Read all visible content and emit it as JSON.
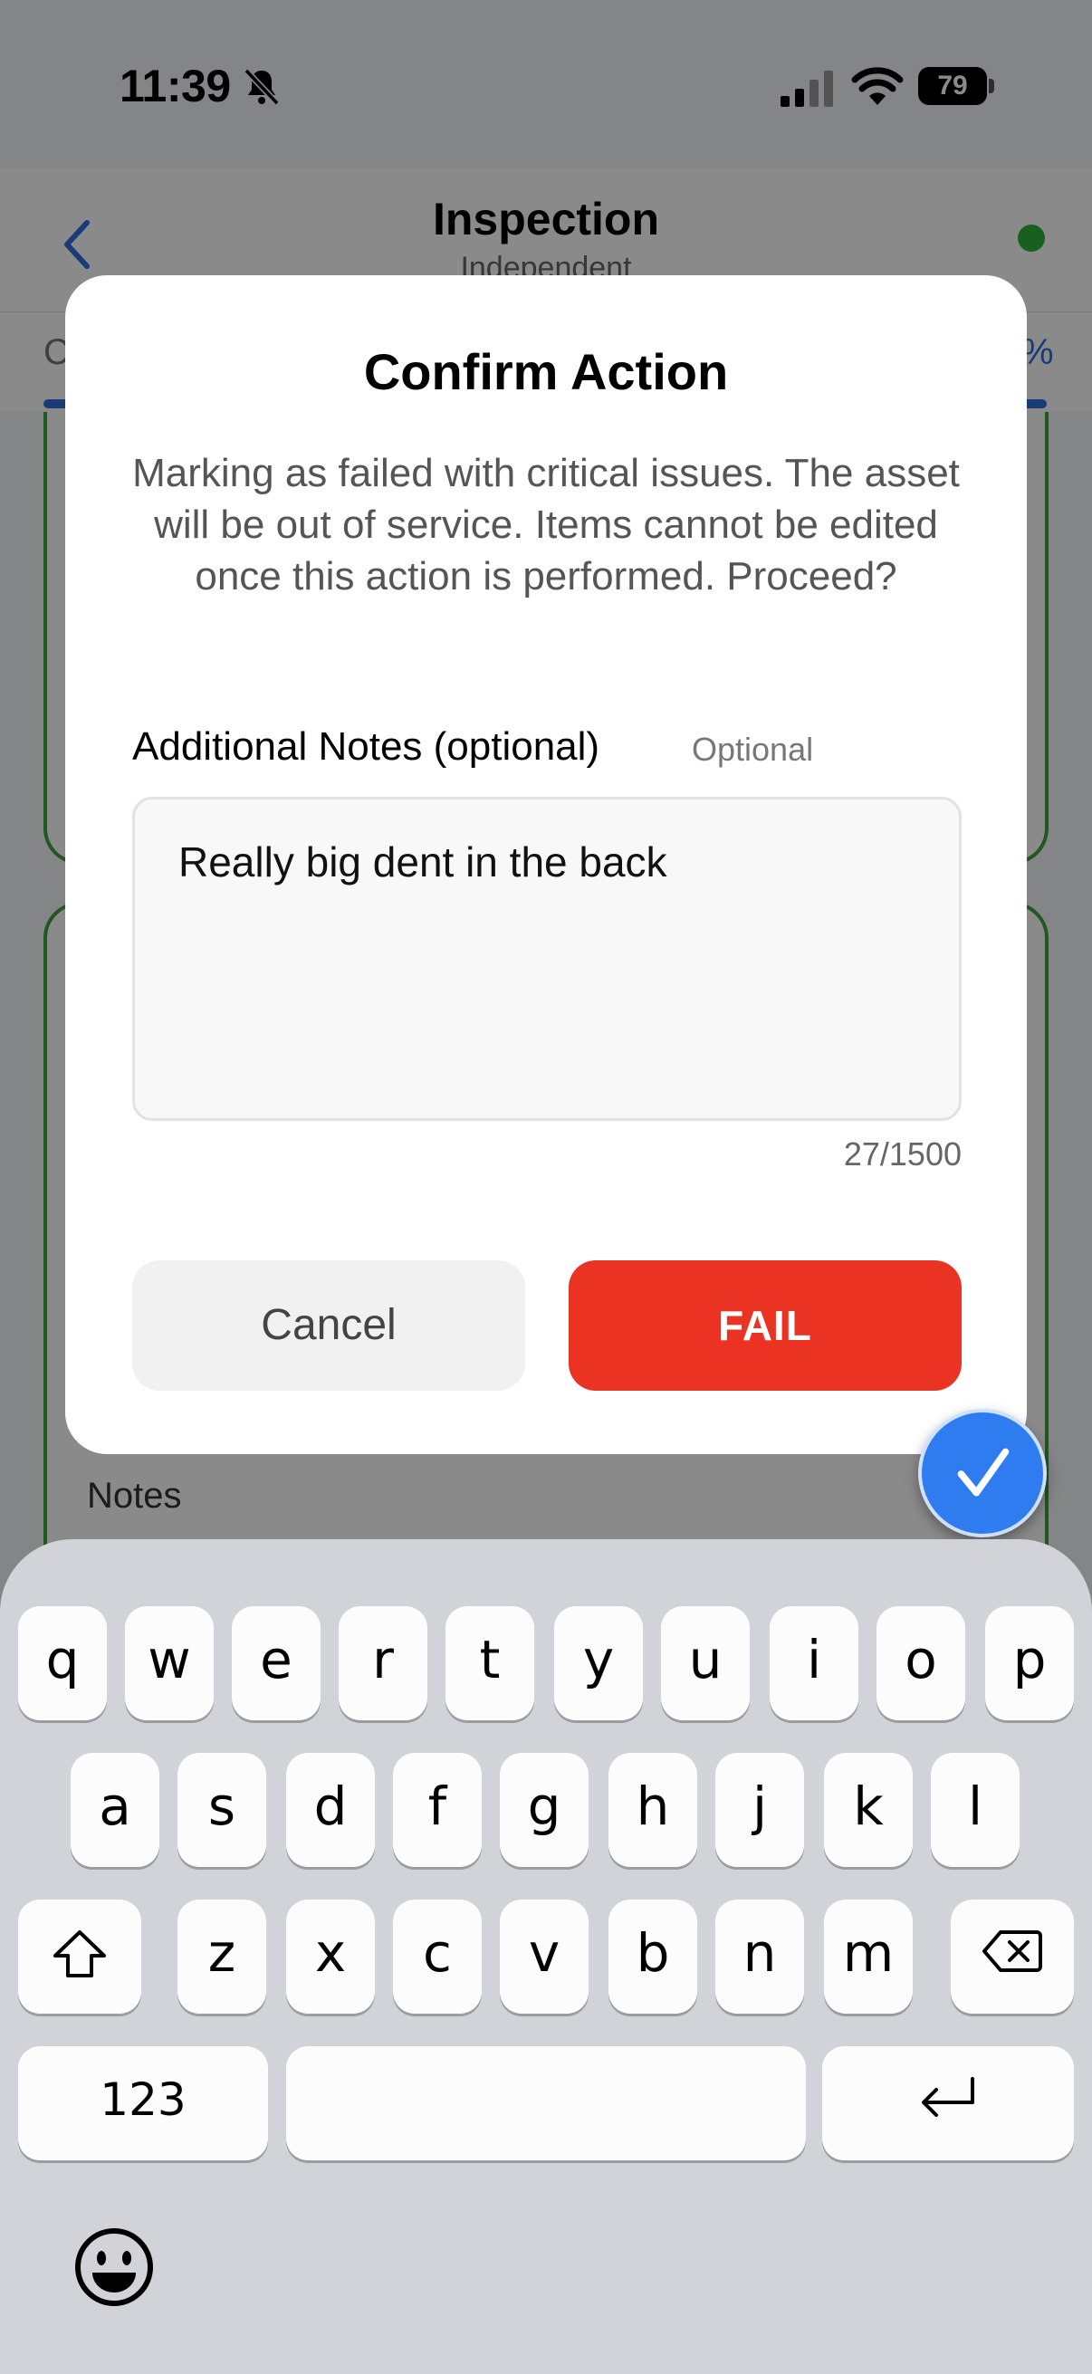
{
  "status_bar": {
    "time": "11:39",
    "battery": "79"
  },
  "nav": {
    "title": "Inspection",
    "subtitle": "Independent"
  },
  "tabs": {
    "partial_left": "C",
    "partial_right": "%"
  },
  "background": {
    "notes_label": "Notes"
  },
  "modal": {
    "title": "Confirm Action",
    "message": "Marking as failed with critical issues. The asset will be out of service. Items cannot be edited once this action is performed. Proceed?",
    "notes_label": "Additional Notes (optional)",
    "optional_tag": "Optional",
    "notes_value": "Really big dent in the back",
    "char_counter": "27/1500",
    "cancel_label": "Cancel",
    "fail_label": "FAIL"
  },
  "keyboard": {
    "row1": [
      "q",
      "w",
      "e",
      "r",
      "t",
      "y",
      "u",
      "i",
      "o",
      "p"
    ],
    "row2": [
      "a",
      "s",
      "d",
      "f",
      "g",
      "h",
      "j",
      "k",
      "l"
    ],
    "row3": [
      "z",
      "x",
      "c",
      "v",
      "b",
      "n",
      "m"
    ],
    "numbers_label": "123"
  },
  "colors": {
    "fail": "#ea3323",
    "accent": "#2f7cf0",
    "online": "#2fb23a",
    "card_border": "#3ca33a"
  }
}
